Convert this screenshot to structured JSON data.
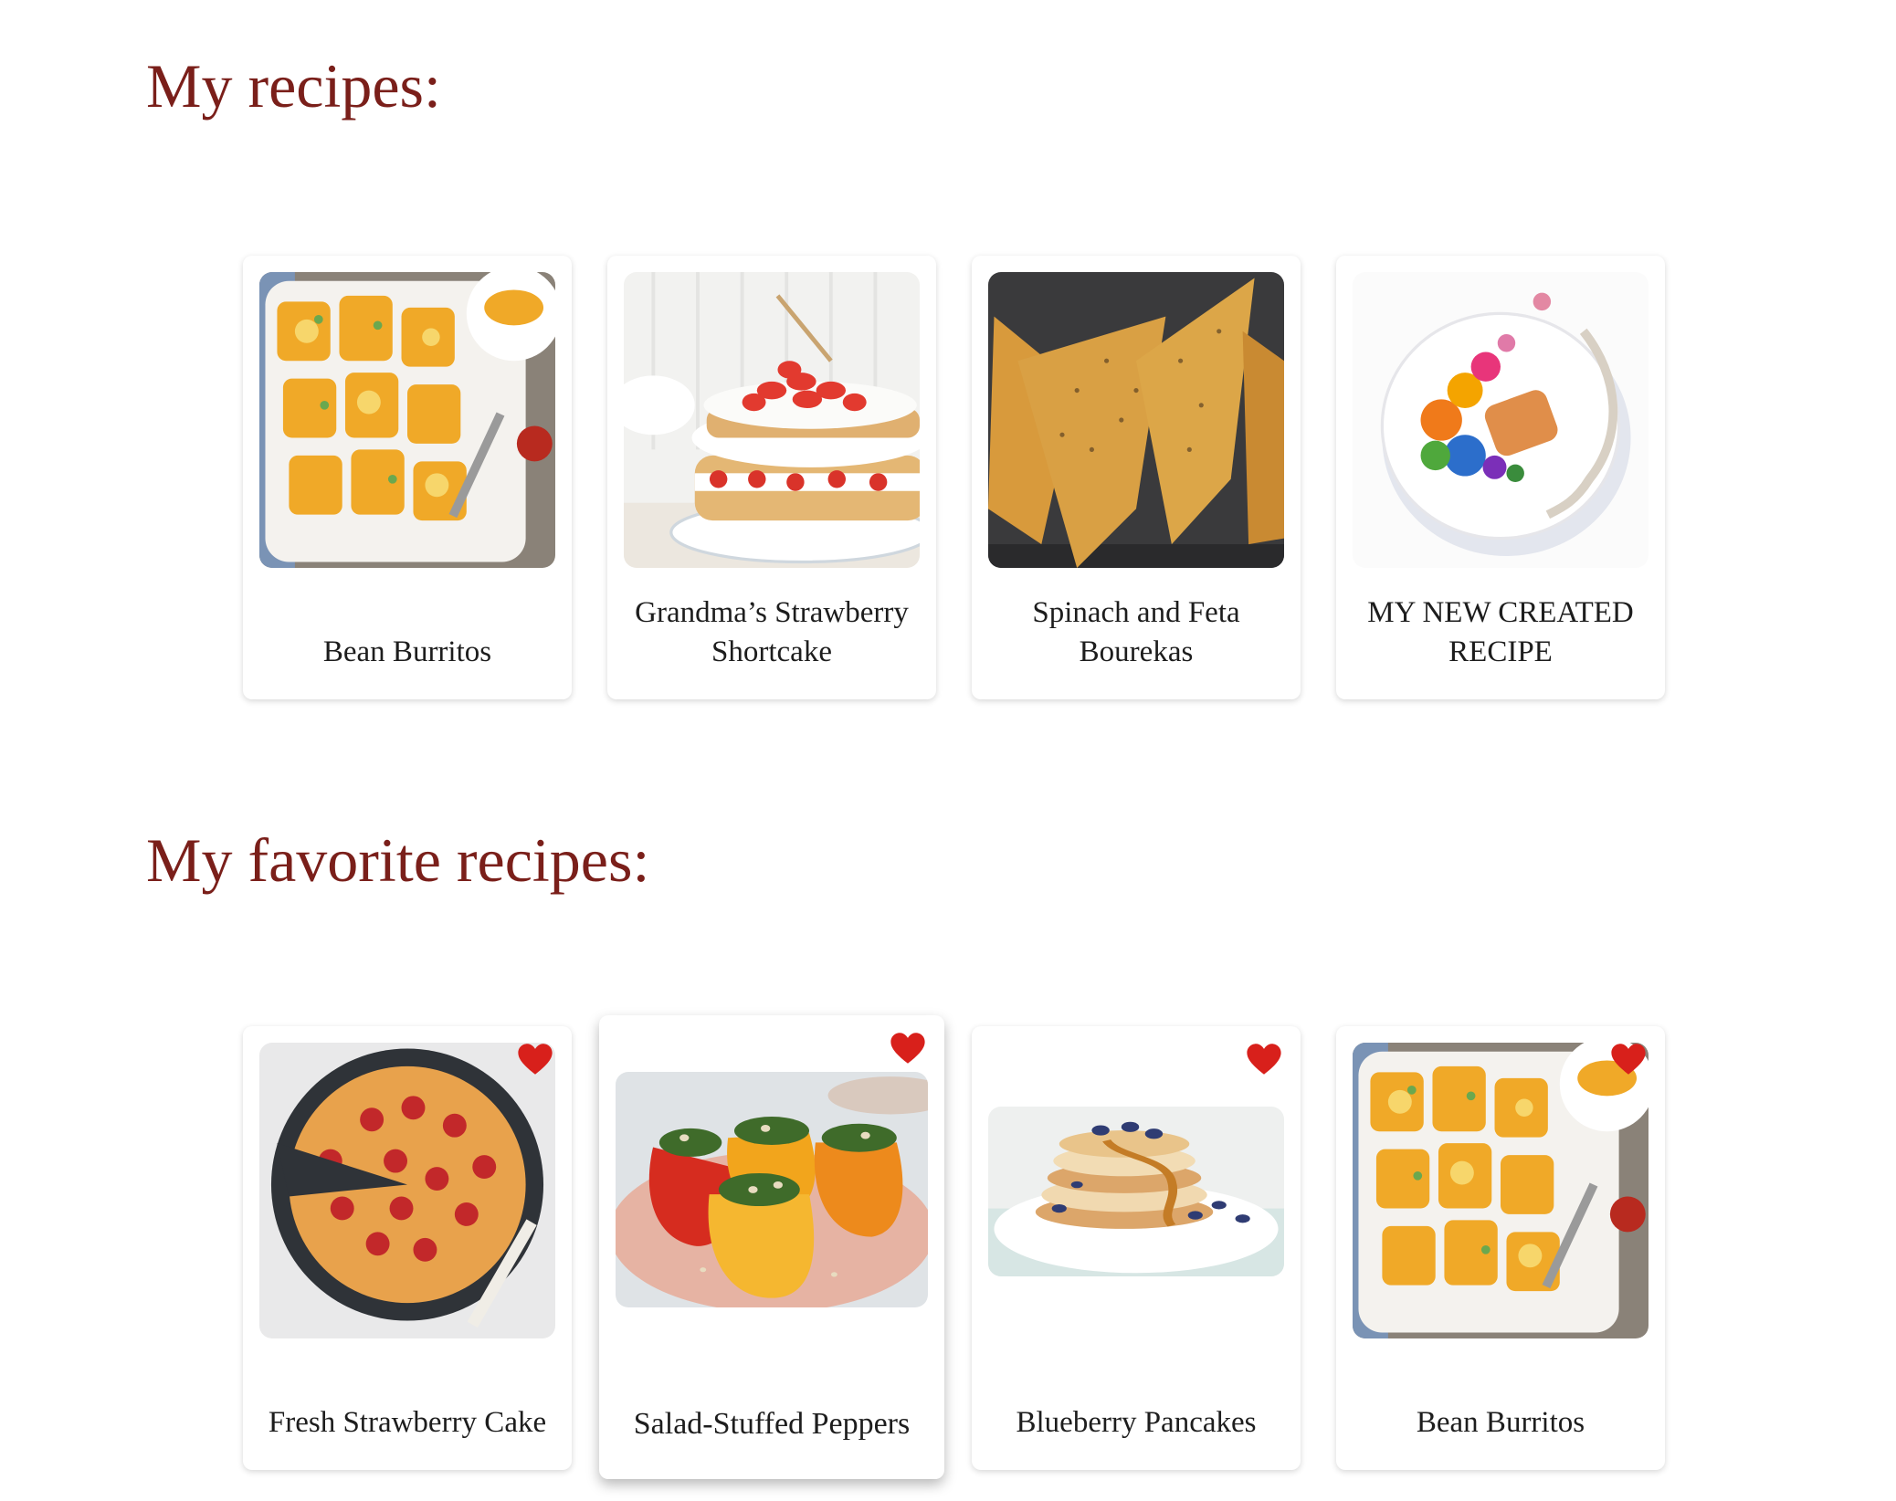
{
  "sections": {
    "my_recipes": {
      "title": "My recipes:"
    },
    "favorites": {
      "title": "My favorite recipes:"
    }
  },
  "my_recipes": [
    {
      "label": "Bean Burritos"
    },
    {
      "label": "Grandma’s Strawberry Shortcake"
    },
    {
      "label": "Spinach and Feta Bourekas"
    },
    {
      "label": "MY NEW CREATED RECIPE"
    }
  ],
  "favorites": [
    {
      "label": "Fresh Strawberry Cake"
    },
    {
      "label": "Salad-Stuffed Peppers"
    },
    {
      "label": "Blueberry Pancakes"
    },
    {
      "label": "Bean Burritos"
    }
  ],
  "icons": {
    "favorite": "heart-icon"
  },
  "colors": {
    "title": "#7a1f1a",
    "heart": "#d8201b"
  }
}
